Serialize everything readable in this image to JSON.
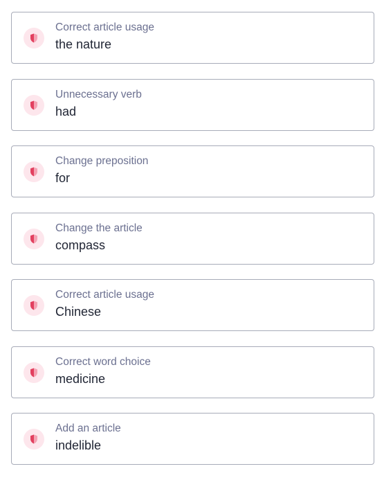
{
  "colors": {
    "accent": "#e2405f",
    "icon_bg": "#fde6ec",
    "border": "#a7abb8",
    "title_text": "#6b7090",
    "value_text": "#1f2433"
  },
  "suggestions": [
    {
      "title": "Correct article usage",
      "value": "the nature",
      "icon": "shield-icon"
    },
    {
      "title": "Unnecessary verb",
      "value": "had",
      "icon": "shield-icon"
    },
    {
      "title": "Change preposition",
      "value": "for",
      "icon": "shield-icon"
    },
    {
      "title": "Change the article",
      "value": "compass",
      "icon": "shield-icon"
    },
    {
      "title": "Correct article usage",
      "value": "Chinese",
      "icon": "shield-icon"
    },
    {
      "title": "Correct word choice",
      "value": "medicine",
      "icon": "shield-icon"
    },
    {
      "title": "Add an article",
      "value": "indelible",
      "icon": "shield-icon"
    }
  ]
}
